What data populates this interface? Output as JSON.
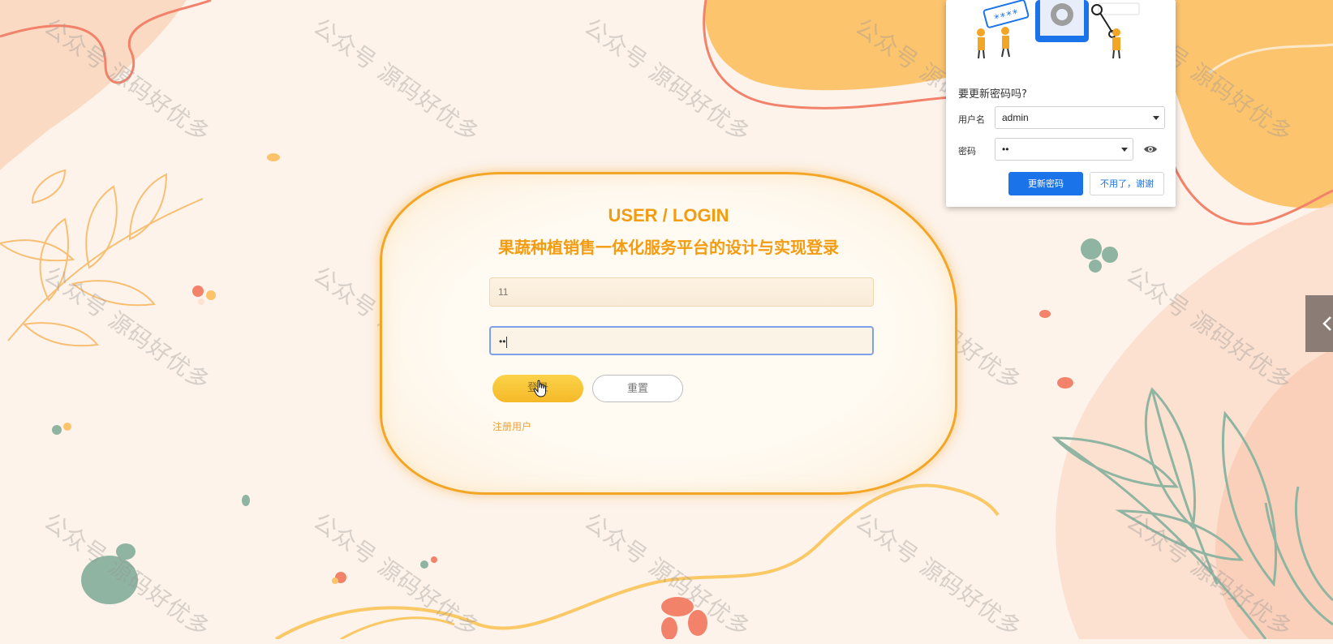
{
  "login": {
    "title": "USER / LOGIN",
    "subtitle": "果蔬种植销售一体化服务平台的设计与实现登录",
    "username_value": "11",
    "password_value": "••",
    "login_button": "登录",
    "reset_button": "重置",
    "register_link": "注册用户"
  },
  "password_popup": {
    "illustration_text": "****",
    "question": "要更新密码吗?",
    "username_label": "用户名",
    "username_value": "admin",
    "password_label": "密码",
    "password_value": "••",
    "update_button": "更新密码",
    "dismiss_button": "不用了，谢谢"
  },
  "watermark": "公众号 源码好优多",
  "side_tab": {
    "icon": "chevron-left-icon"
  },
  "colors": {
    "accent": "#f39c12",
    "background": "#fdf3ea",
    "primary_blue": "#1a73e8",
    "green": "#8fb5a2",
    "coral": "#f26d5b"
  }
}
